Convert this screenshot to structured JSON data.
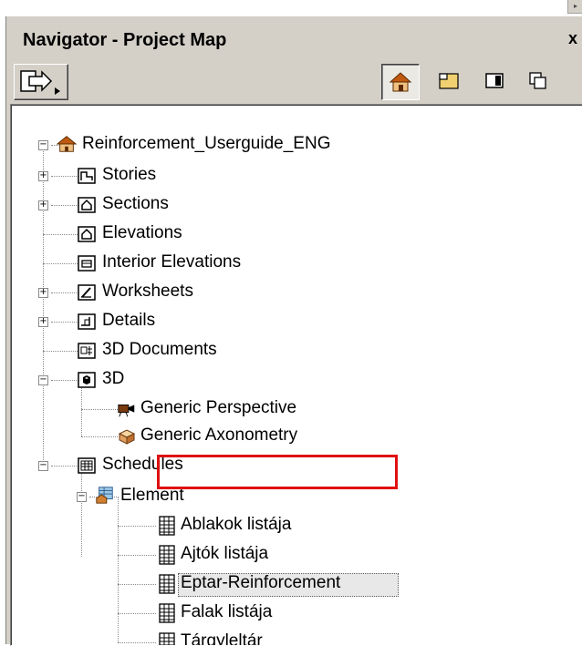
{
  "window": {
    "title": "Navigator - Project Map",
    "close_glyph": "x",
    "corner_glyph": "▸"
  },
  "toolbar": {
    "left_button_icon": "publisher-arrow-icon",
    "view_buttons": [
      {
        "name": "project-map-icon",
        "selected": true
      },
      {
        "name": "view-map-icon",
        "selected": false
      },
      {
        "name": "layout-book-icon",
        "selected": false
      },
      {
        "name": "publisher-sets-icon",
        "selected": false
      }
    ]
  },
  "tree": {
    "root": "Reinforcement_Userguide_ENG",
    "items": [
      {
        "label": "Stories",
        "icon": "stories-icon",
        "expander": "+"
      },
      {
        "label": "Sections",
        "icon": "sections-icon",
        "expander": "+"
      },
      {
        "label": "Elevations",
        "icon": "elevations-icon",
        "expander": ""
      },
      {
        "label": "Interior Elevations",
        "icon": "interior-elevations-icon",
        "expander": ""
      },
      {
        "label": "Worksheets",
        "icon": "worksheets-icon",
        "expander": "+"
      },
      {
        "label": "Details",
        "icon": "details-icon",
        "expander": "+"
      },
      {
        "label": "3D Documents",
        "icon": "3d-documents-icon",
        "expander": ""
      },
      {
        "label": "3D",
        "icon": "3d-icon",
        "expander": "−"
      },
      {
        "label": "Generic Perspective",
        "icon": "camera-icon",
        "expander": ""
      },
      {
        "label": "Generic Axonometry",
        "icon": "axonometry-icon",
        "expander": ""
      },
      {
        "label": "Schedules",
        "icon": "schedules-icon",
        "expander": "−"
      },
      {
        "label": "Element",
        "icon": "element-schedule-icon",
        "expander": "−"
      },
      {
        "label": "Ablakok listája",
        "icon": "schedule-table-icon",
        "expander": ""
      },
      {
        "label": "Ajtók listája",
        "icon": "schedule-table-icon",
        "expander": ""
      },
      {
        "label": "Eptar-Reinforcement",
        "icon": "schedule-table-icon",
        "expander": "",
        "selected": true
      },
      {
        "label": "Falak listája",
        "icon": "schedule-table-icon",
        "expander": ""
      },
      {
        "label": "Tárgyleltár",
        "icon": "schedule-table-icon",
        "expander": ""
      }
    ]
  },
  "colors": {
    "highlight_box": "#e01010",
    "panel_bg": "#d4d0c8"
  }
}
